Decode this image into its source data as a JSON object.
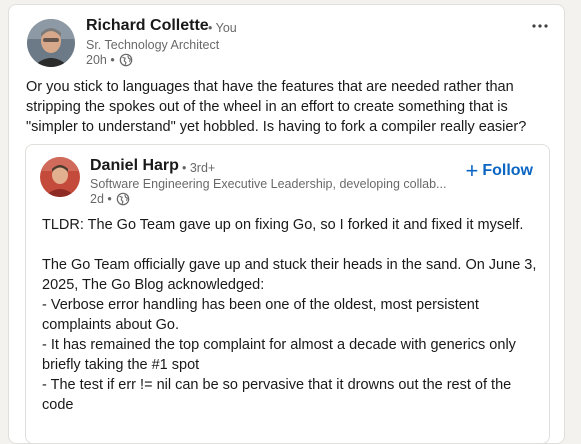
{
  "post": {
    "author": {
      "name": "Richard Collette",
      "degree": "• You",
      "headline": "Sr. Technology Architect",
      "time": "20h •",
      "visibility_icon": "globe-icon"
    },
    "more_icon": "more-horizontal-icon",
    "text_lines": [
      "Or you stick to languages that have the features that are needed rather than",
      "stripping the spokes out of the wheel in an effort to create something that is",
      "\"simpler to understand\" yet hobbled. Is having to fork a compiler really easier?"
    ]
  },
  "repost": {
    "author": {
      "name": "Daniel Harp",
      "degree": "• 3rd+",
      "headline": "Software Engineering Executive Leadership, developing collab...",
      "time": "2d •",
      "visibility_icon": "globe-icon"
    },
    "follow_label": "Follow",
    "follow_color": "#0a66c2",
    "text_lines": [
      "TLDR: The Go Team gave up on fixing Go, so I forked it and fixed it myself.",
      "",
      "The Go Team officially gave up and stuck their heads in the sand. On June 3,",
      "2025, The Go Blog acknowledged:",
      "- Verbose error handling has been one of the oldest, most persistent",
      "complaints about Go.",
      "- It has remained the top complaint for almost a decade with generics only",
      "briefly taking the #1 spot",
      "- The test if err != nil can be so pervasive that it drowns out the rest of the",
      "code"
    ]
  }
}
